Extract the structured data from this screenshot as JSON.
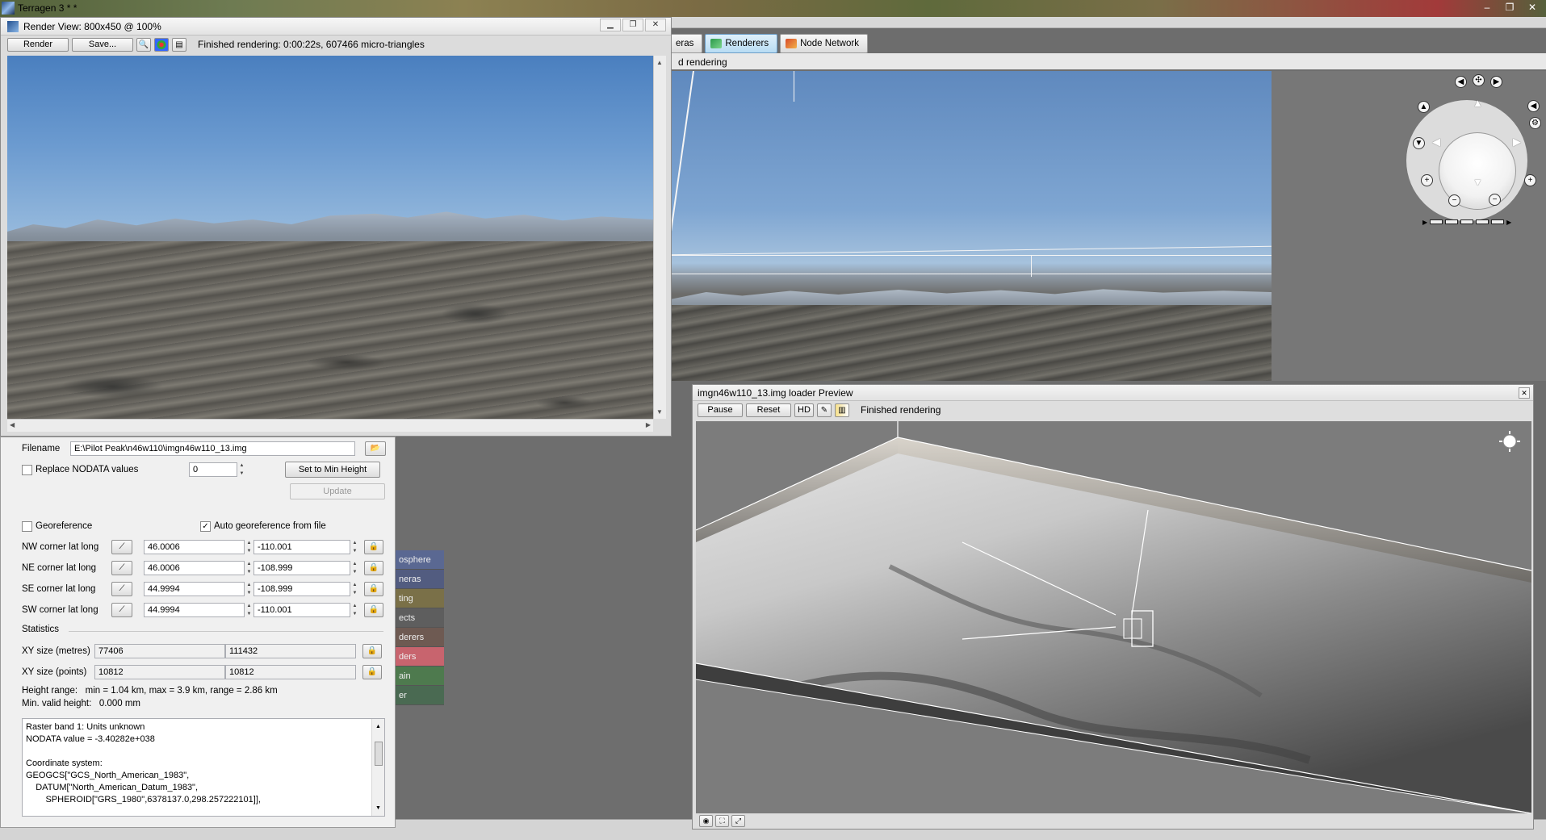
{
  "app": {
    "title": "Terragen 3 * *",
    "window_buttons": [
      "–",
      "❐",
      "✕"
    ]
  },
  "tabs": [
    {
      "label": "eras",
      "icon": "cameras-icon",
      "active": false
    },
    {
      "label": "Renderers",
      "icon": "renderers-icon",
      "active": true
    },
    {
      "label": "Node Network",
      "icon": "node-network-icon",
      "active": false
    }
  ],
  "viewport": {
    "status": "d rendering"
  },
  "node_list": [
    {
      "label": "osphere",
      "color": "#5a6892"
    },
    {
      "label": "neras",
      "color": "#525c80"
    },
    {
      "label": "ting",
      "color": "#7a7048"
    },
    {
      "label": "ects",
      "color": "#5e5e5e"
    },
    {
      "label": "derers",
      "color": "#6e5a52"
    },
    {
      "label": "ders",
      "color": "#c8646e"
    },
    {
      "label": "ain",
      "color": "#4e7a4e"
    },
    {
      "label": "er",
      "color": "#4a6a52"
    }
  ],
  "render_view": {
    "title": "Render View: 800x450 @ 100%",
    "render_btn": "Render",
    "save_btn": "Save...",
    "status": "Finished rendering:  0:00:22s, 607466 micro-triangles",
    "window_buttons": [
      "▁",
      "❐",
      "✕"
    ]
  },
  "loader": {
    "filename_label": "Filename",
    "filename_value": "E:\\Pilot Peak\\n46w110\\imgn46w110_13.img",
    "replace_nodata_label": "Replace NODATA values",
    "replace_nodata_checked": false,
    "nodata_value": "0",
    "set_min_height_btn": "Set to Min Height",
    "update_btn": "Update",
    "georeference_label": "Georeference",
    "georeference_checked": false,
    "auto_georeference_label": "Auto georeference from file",
    "auto_georeference_checked": true,
    "corners": [
      {
        "label": "NW corner lat long",
        "lat": "46.0006",
        "lon": "-110.001"
      },
      {
        "label": "NE corner lat long",
        "lat": "46.0006",
        "lon": "-108.999"
      },
      {
        "label": "SE corner lat long",
        "lat": "44.9994",
        "lon": "-108.999"
      },
      {
        "label": "SW corner lat long",
        "lat": "44.9994",
        "lon": "-110.001"
      }
    ],
    "statistics_label": "Statistics",
    "xy_size_m_label": "XY size (metres)",
    "xy_size_m": [
      "77406",
      "111432"
    ],
    "xy_size_pts_label": "XY size (points)",
    "xy_size_pts": [
      "10812",
      "10812"
    ],
    "height_range": "Height range:   min = 1.04 km, max = 3.9 km, range = 2.86 km",
    "min_valid_height": "Min. valid height:   0.000 mm",
    "info_lines": [
      "Raster band 1: Units unknown",
      "NODATA value = -3.40282e+038",
      "",
      "Coordinate system:",
      "GEOGCS[\"GCS_North_American_1983\",",
      "    DATUM[\"North_American_Datum_1983\",",
      "        SPHEROID[\"GRS_1980\",6378137.0,298.257222101]],"
    ]
  },
  "preview": {
    "title": "imgn46w110_13.img loader Preview",
    "pause_btn": "Pause",
    "reset_btn": "Reset",
    "hd_btn": "HD",
    "status": "Finished rendering"
  }
}
